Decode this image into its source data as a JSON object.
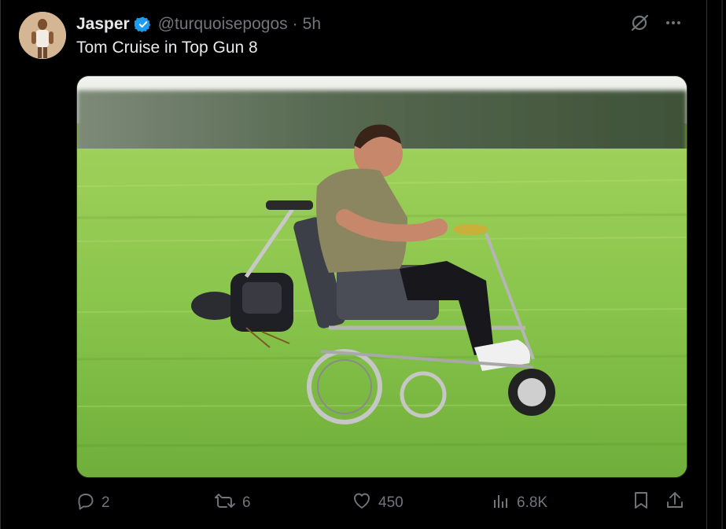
{
  "tweet": {
    "author_name": "Jasper",
    "handle": "@turquoisepogos",
    "separator": "·",
    "time": "5h",
    "text": "Tom Cruise in Top Gun 8",
    "verified": true
  },
  "media": {
    "description_icon": "photo"
  },
  "actions": {
    "reply_count": "2",
    "repost_count": "6",
    "like_count": "450",
    "views_count": "6.8K"
  },
  "icons": {
    "verified": "verified-badge-icon",
    "grok": "grok-icon",
    "more": "more-icon",
    "reply": "reply-icon",
    "repost": "repost-icon",
    "like": "heart-icon",
    "views": "analytics-icon",
    "bookmark": "bookmark-icon",
    "share": "share-icon"
  },
  "colors": {
    "background": "#000000",
    "text": "#e7e9ea",
    "muted": "#71767b",
    "verified": "#1d9bf0",
    "border": "#2f3336"
  }
}
